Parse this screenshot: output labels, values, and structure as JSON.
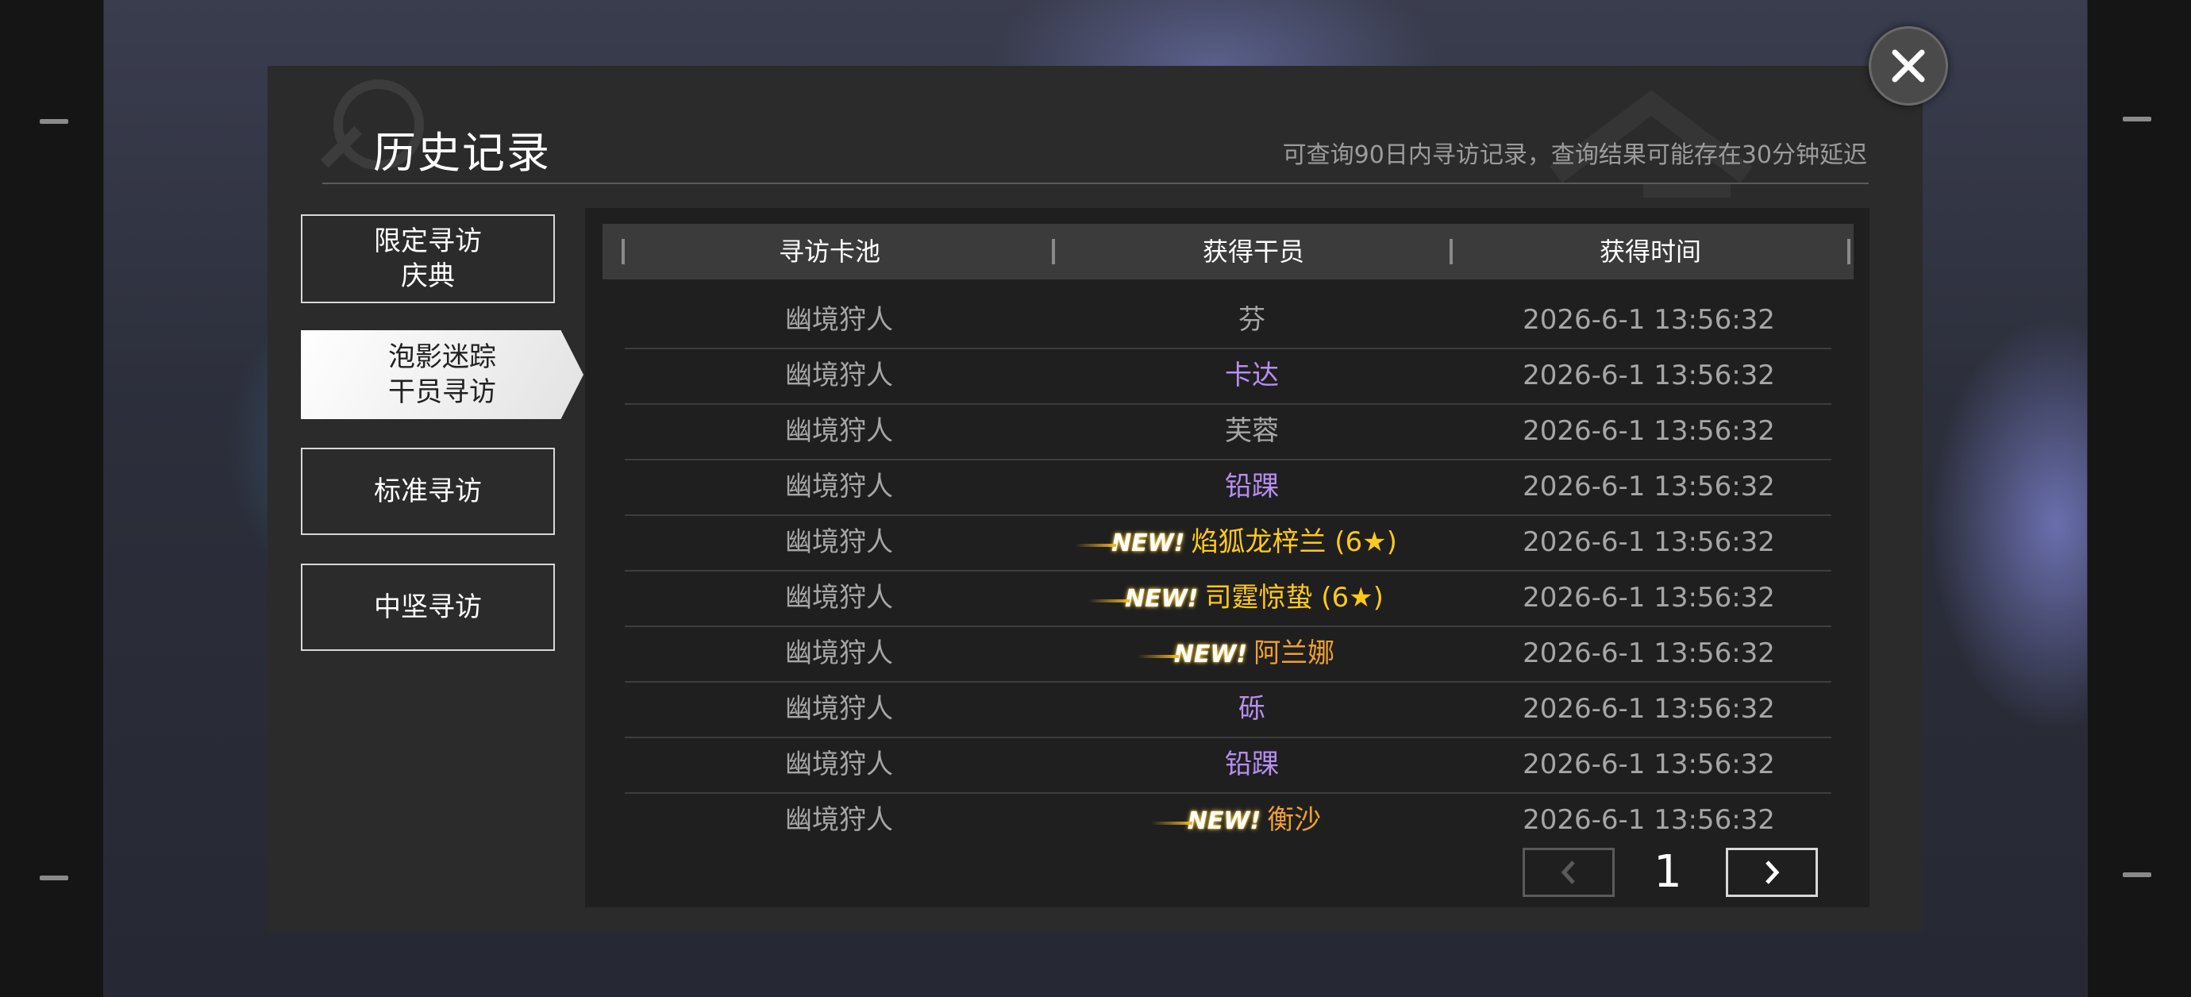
{
  "dialog": {
    "title": "历史记录",
    "subtitle": "可查询90日内寻访记录，查询结果可能存在30分钟延迟"
  },
  "tabs": [
    {
      "label": "限定寻访\n庆典",
      "active": false
    },
    {
      "label": "泡影迷踪\n干员寻访",
      "active": true
    },
    {
      "label": "标准寻访",
      "active": false
    },
    {
      "label": "中坚寻访",
      "active": false
    }
  ],
  "table": {
    "headers": [
      "寻访卡池",
      "获得干员",
      "获得时间"
    ],
    "rows": [
      {
        "pool": "幽境狩人",
        "operator": "芬",
        "new": false,
        "stars": "",
        "rarity_color": "#a6a6a6",
        "time": "2026-6-1 13:56:32"
      },
      {
        "pool": "幽境狩人",
        "operator": "卡达",
        "new": false,
        "stars": "",
        "rarity_color": "#b88ef0",
        "time": "2026-6-1 13:56:32"
      },
      {
        "pool": "幽境狩人",
        "operator": "芙蓉",
        "new": false,
        "stars": "",
        "rarity_color": "#a6a6a6",
        "time": "2026-6-1 13:56:32"
      },
      {
        "pool": "幽境狩人",
        "operator": "铅踝",
        "new": false,
        "stars": "",
        "rarity_color": "#b88ef0",
        "time": "2026-6-1 13:56:32"
      },
      {
        "pool": "幽境狩人",
        "operator": "焰狐龙梓兰",
        "new": true,
        "stars": " (6★)",
        "rarity_color": "#ffc91a",
        "time": "2026-6-1 13:56:32"
      },
      {
        "pool": "幽境狩人",
        "operator": "司霆惊蛰",
        "new": true,
        "stars": " (6★)",
        "rarity_color": "#ffc91a",
        "time": "2026-6-1 13:56:32"
      },
      {
        "pool": "幽境狩人",
        "operator": "阿兰娜",
        "new": true,
        "stars": "",
        "rarity_color": "#f0a030",
        "time": "2026-6-1 13:56:32"
      },
      {
        "pool": "幽境狩人",
        "operator": "砾",
        "new": false,
        "stars": "",
        "rarity_color": "#b88ef0",
        "time": "2026-6-1 13:56:32"
      },
      {
        "pool": "幽境狩人",
        "operator": "铅踝",
        "new": false,
        "stars": "",
        "rarity_color": "#b88ef0",
        "time": "2026-6-1 13:56:32"
      },
      {
        "pool": "幽境狩人",
        "operator": "衡沙",
        "new": true,
        "stars": "",
        "rarity_color": "#f0a030",
        "time": "2026-6-1 13:56:32"
      }
    ],
    "new_label": "NEW!"
  },
  "pagination": {
    "current_page": "1",
    "prev_icon": "chevron-left-icon",
    "next_icon": "chevron-right-icon"
  },
  "colors": {
    "six_star": "#ffc91a",
    "five_star": "#f0a030",
    "four_star": "#b88ef0",
    "three_star": "#a6a6a6"
  }
}
